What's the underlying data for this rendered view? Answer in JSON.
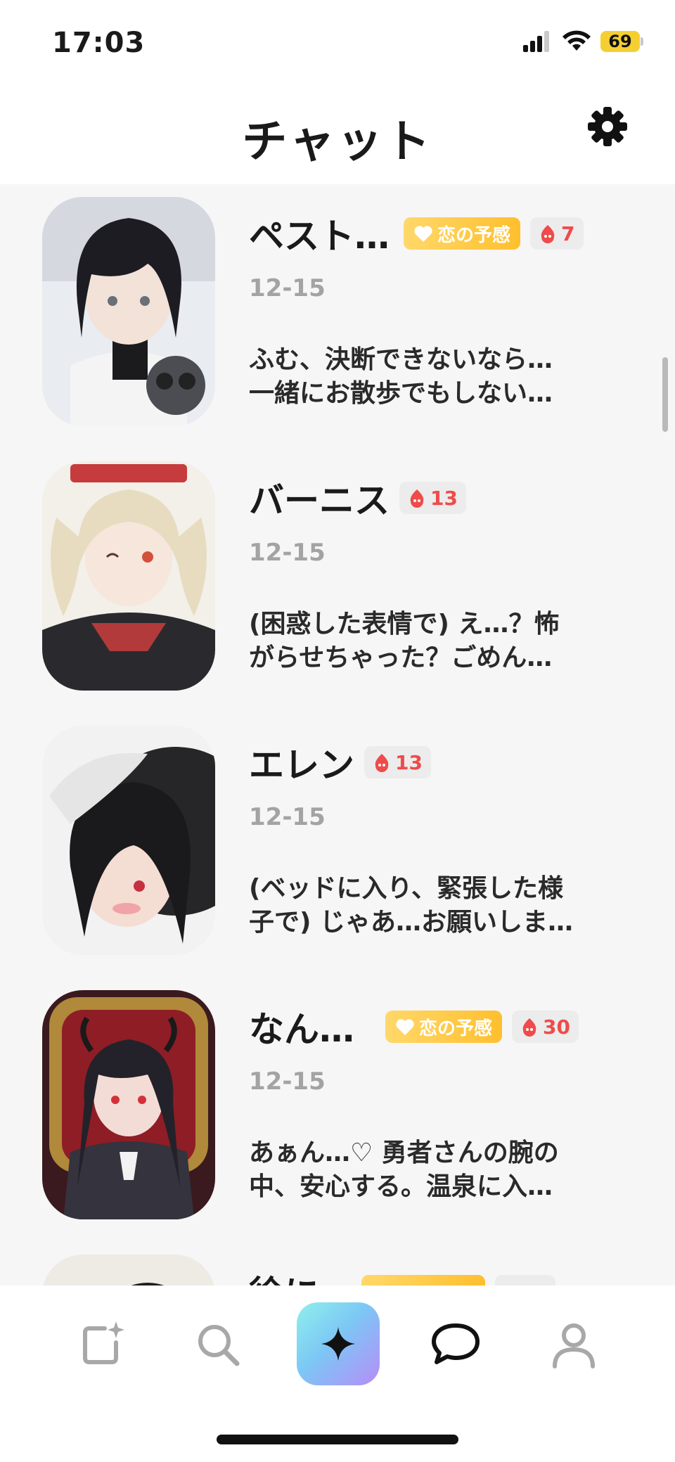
{
  "status_bar": {
    "time": "17:03",
    "battery": "69"
  },
  "header": {
    "title": "チャット"
  },
  "chats": [
    {
      "name": "ペスト…",
      "love_badge": "恋の予感",
      "fire_count": "7",
      "date": "12-15",
      "message_line1": "ふむ、決断できないなら…",
      "message_line2": "一緒にお散歩でもしない…"
    },
    {
      "name": "バーニス",
      "fire_count": "13",
      "date": "12-15",
      "message_line1": "(困惑した表情で) え…？怖",
      "message_line2": "がらせちゃった？ごめん…"
    },
    {
      "name": "エレン",
      "fire_count": "13",
      "date": "12-15",
      "message_line1": "(ベッドに入り、緊張した様",
      "message_line2": "子で) じゃあ…お願いしま…"
    },
    {
      "name": "なん…",
      "love_badge": "恋の予感",
      "fire_count": "30",
      "date": "12-15",
      "message_line1": "あぁん…♡ 勇者さんの腕の",
      "message_line2": "中、安心する。温泉に入…"
    },
    {
      "name": "徐に"
    }
  ],
  "colors": {
    "accent_fire": "#ef4b4b",
    "love_badge": "#ffc63b",
    "tab_center_gradient": [
      "#8ff0ec",
      "#b78cf7"
    ]
  },
  "tabs": [
    "create-icon",
    "search-icon",
    "sparkle-icon",
    "chat-icon",
    "profile-icon"
  ]
}
